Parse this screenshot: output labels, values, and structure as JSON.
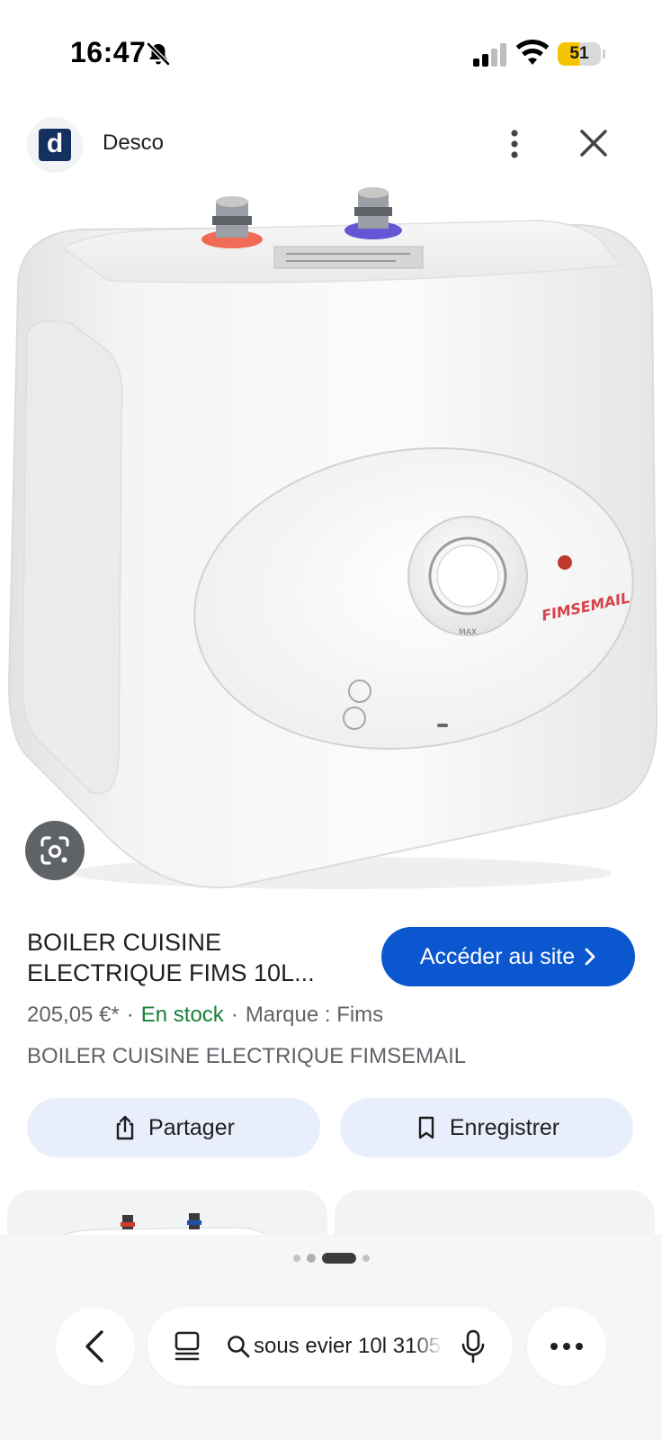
{
  "status_bar": {
    "time": "16:47",
    "battery_level": "51",
    "battery_fraction": 0.51,
    "icons": [
      "bell-slash-icon",
      "cellular-signal-icon",
      "wifi-icon",
      "battery-icon"
    ]
  },
  "source": {
    "favicon_letter": "d",
    "name": "Desco",
    "icons": [
      "more-vertical-icon",
      "close-icon"
    ]
  },
  "image": {
    "brand_mark": "FIMSEMAIL",
    "dial_label": "MAX",
    "lens_icon": "google-lens-icon"
  },
  "product": {
    "title": "BOILER CUISINE ELECTRIQUE FIMS 10L...",
    "visit_label": "Accéder au site",
    "price": "205,05 €*",
    "separator": "·",
    "stock": "En stock",
    "brand": "Marque : Fims",
    "description": "BOILER CUISINE ELECTRIQUE FIMSEMAIL"
  },
  "actions": {
    "share_label": "Partager",
    "save_label": "Enregistrer"
  },
  "bottom_bar": {
    "search_query": "sous evier 10l 3105",
    "icons": [
      "back-chevron-icon",
      "tabs-icon",
      "search-icon",
      "microphone-icon",
      "more-horizontal-icon"
    ]
  },
  "colors": {
    "accent_button": "#0b57d0",
    "stock_green": "#188038",
    "pill_background": "#e8eefb",
    "battery_yellow": "#f5c400",
    "favicon_navy": "#13305f"
  }
}
